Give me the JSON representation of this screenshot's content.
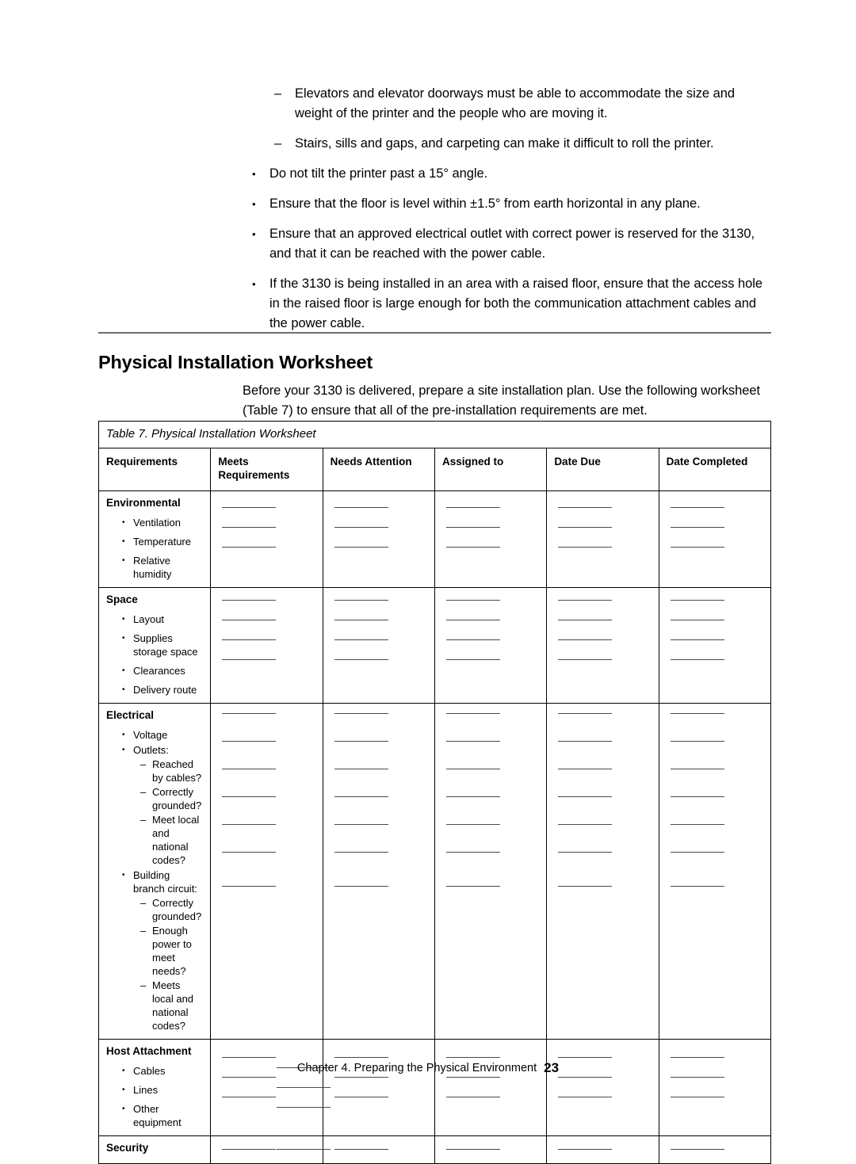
{
  "intro_bullets": [
    {
      "marker": "dash",
      "text": "Elevators and elevator doorways must be able to accommodate the size and weight of the printer and the people who are moving it."
    },
    {
      "marker": "dash",
      "text": "Stairs, sills and gaps, and carpeting can make it difficult to roll the printer."
    },
    {
      "marker": "dot",
      "text": "Do not tilt the printer past a 15° angle."
    },
    {
      "marker": "dot",
      "text": "Ensure that the floor is level within ±1.5° from earth horizontal in any plane."
    },
    {
      "marker": "dot",
      "text": "Ensure that an approved electrical outlet with correct power is reserved for the 3130, and that it can be reached with the power cable."
    },
    {
      "marker": "dot",
      "text": "If the 3130 is being installed in an area with a raised floor, ensure that the access hole in the raised floor is large enough for both the communication attachment cables and the power cable."
    }
  ],
  "section": {
    "heading": "Physical Installation Worksheet",
    "paragraph": "Before your 3130 is delivered, prepare a site installation plan.  Use the following worksheet (Table  7) to ensure that all of the pre-installation requirements are met."
  },
  "table": {
    "caption": "Table  7. Physical Installation Worksheet",
    "columns": [
      "Requirements",
      "Meets Requirements",
      "Needs Attention",
      "Assigned to",
      "Date Due",
      "Date Completed"
    ],
    "groups": [
      {
        "title": "Environmental",
        "items": [
          {
            "level": 1,
            "marker": "•",
            "text": "Ventilation"
          },
          {
            "level": 1,
            "marker": "•",
            "text": "Temperature"
          },
          {
            "level": 1,
            "marker": "•",
            "text": "Relative humidity"
          }
        ],
        "line_count": 3
      },
      {
        "title": "Space",
        "items": [
          {
            "level": 1,
            "marker": "•",
            "text": "Layout"
          },
          {
            "level": 1,
            "marker": "•",
            "text": "Supplies storage space"
          },
          {
            "level": 1,
            "marker": "•",
            "text": "Clearances"
          },
          {
            "level": 1,
            "marker": "•",
            "text": "Delivery route"
          }
        ],
        "line_count": 4
      },
      {
        "title": "Electrical",
        "items": [
          {
            "level": 1,
            "marker": "•",
            "text": "Voltage"
          },
          {
            "level": 1,
            "marker": "•",
            "text": "Outlets:"
          },
          {
            "level": 2,
            "marker": "–",
            "text": "Reached by cables?"
          },
          {
            "level": 2,
            "marker": "–",
            "text": "Correctly grounded?"
          },
          {
            "level": 2,
            "marker": "–",
            "text": "Meet local and national codes?"
          },
          {
            "level": 1,
            "marker": "•",
            "text": "Building branch circuit:"
          },
          {
            "level": 2,
            "marker": "–",
            "text": "Correctly grounded?"
          },
          {
            "level": 2,
            "marker": "–",
            "text": "Enough power to meet needs?"
          },
          {
            "level": 2,
            "marker": "–",
            "text": "Meets local and national codes?"
          }
        ],
        "line_count": 7
      },
      {
        "title": "Host Attachment",
        "items": [
          {
            "level": 1,
            "marker": "•",
            "text": "Cables"
          },
          {
            "level": 1,
            "marker": "•",
            "text": "Lines"
          },
          {
            "level": 1,
            "marker": "•",
            "text": "Other equipment"
          }
        ],
        "line_count": 3
      },
      {
        "title": "Security",
        "items": [],
        "line_count": 1
      }
    ]
  },
  "footer": {
    "text": "Chapter 4.  Preparing the Physical Environment",
    "page": "23"
  }
}
